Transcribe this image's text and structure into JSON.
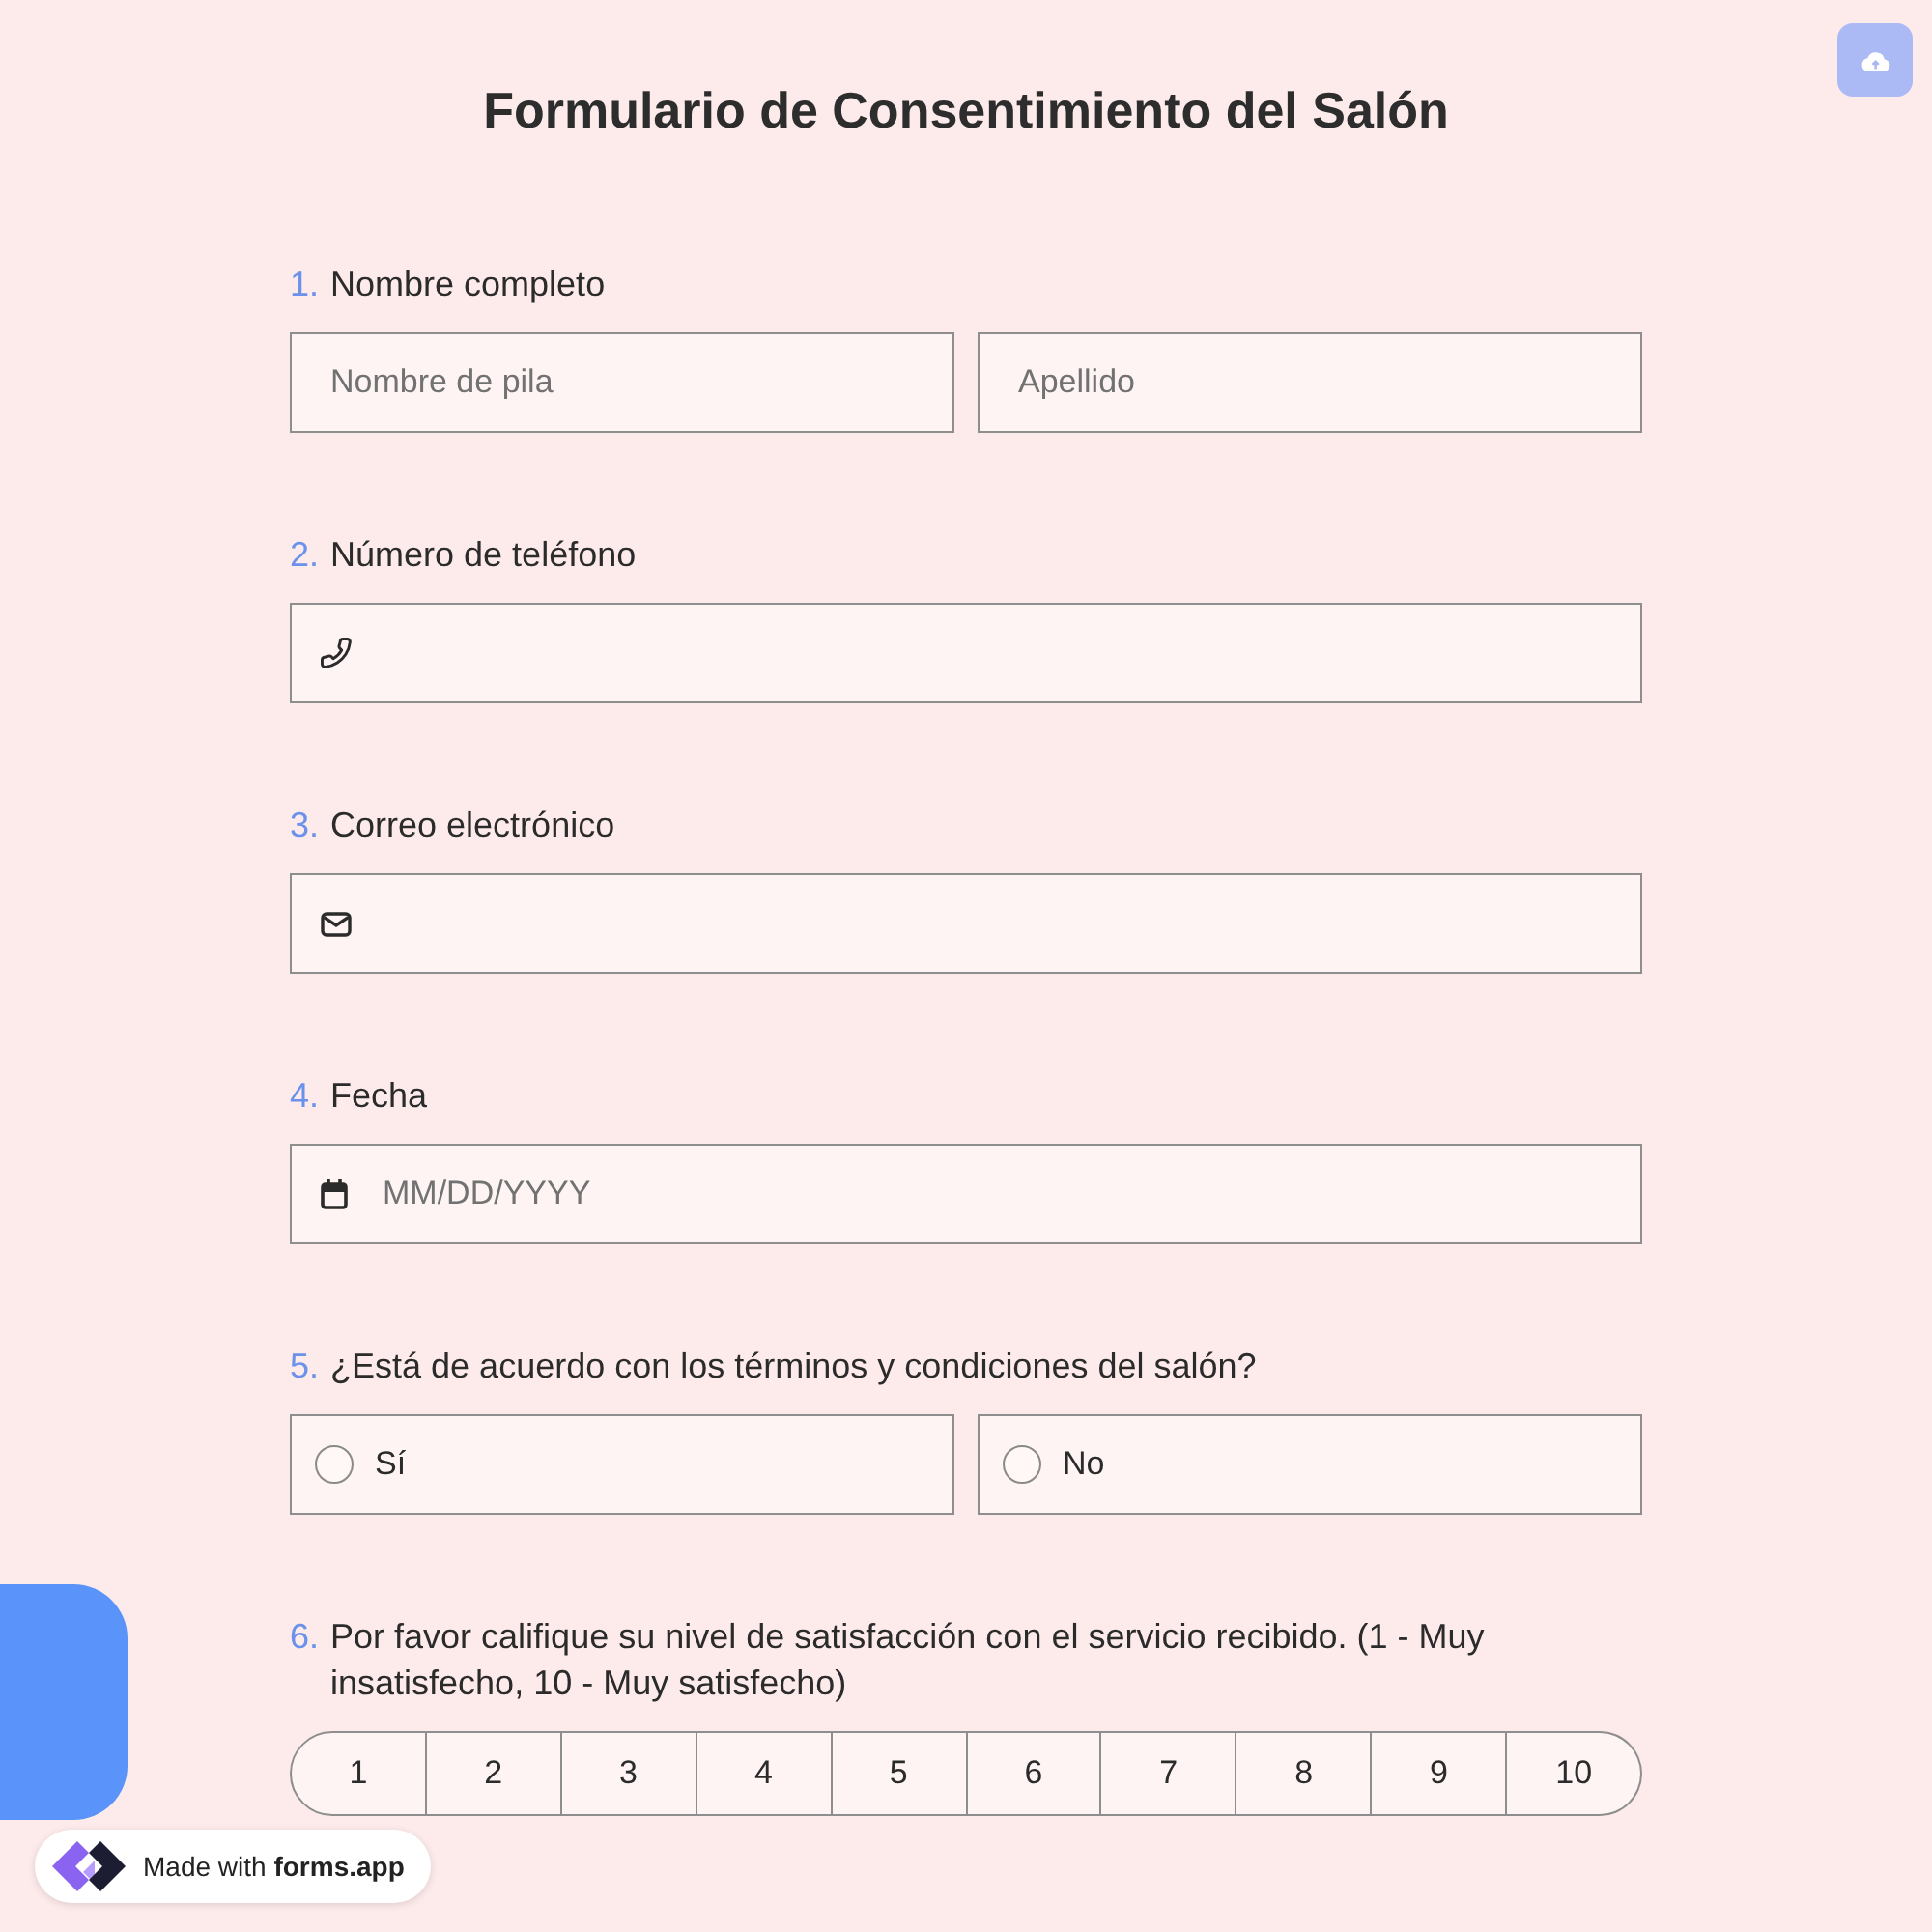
{
  "title": "Formulario de Consentimiento del Salón",
  "questions": [
    {
      "number": "1.",
      "label": "Nombre completo",
      "kind": "name",
      "fields": [
        {
          "placeholder": "Nombre de pila"
        },
        {
          "placeholder": "Apellido"
        }
      ]
    },
    {
      "number": "2.",
      "label": "Número de teléfono",
      "kind": "phone"
    },
    {
      "number": "3.",
      "label": "Correo electrónico",
      "kind": "email"
    },
    {
      "number": "4.",
      "label": "Fecha",
      "kind": "date",
      "placeholder": "MM/DD/YYYY"
    },
    {
      "number": "5.",
      "label": "¿Está de acuerdo con los términos y condiciones del salón?",
      "kind": "choice",
      "options": [
        {
          "label": "Sí",
          "selected": false
        },
        {
          "label": "No",
          "selected": false
        }
      ]
    },
    {
      "number": "6.",
      "label": "Por favor califique su nivel de satisfacción con el servicio recibido. (1 - Muy insatisfecho, 10 - Muy satisfecho)",
      "kind": "scale",
      "options": [
        {
          "label": "1",
          "selected": false
        },
        {
          "label": "2",
          "selected": false
        },
        {
          "label": "3",
          "selected": false
        },
        {
          "label": "4",
          "selected": false
        },
        {
          "label": "5",
          "selected": false
        },
        {
          "label": "6",
          "selected": false
        },
        {
          "label": "7",
          "selected": false
        },
        {
          "label": "8",
          "selected": false
        },
        {
          "label": "9",
          "selected": false
        },
        {
          "label": "10",
          "selected": false
        }
      ]
    }
  ],
  "badge": {
    "text": "Made with **forms.app**"
  }
}
